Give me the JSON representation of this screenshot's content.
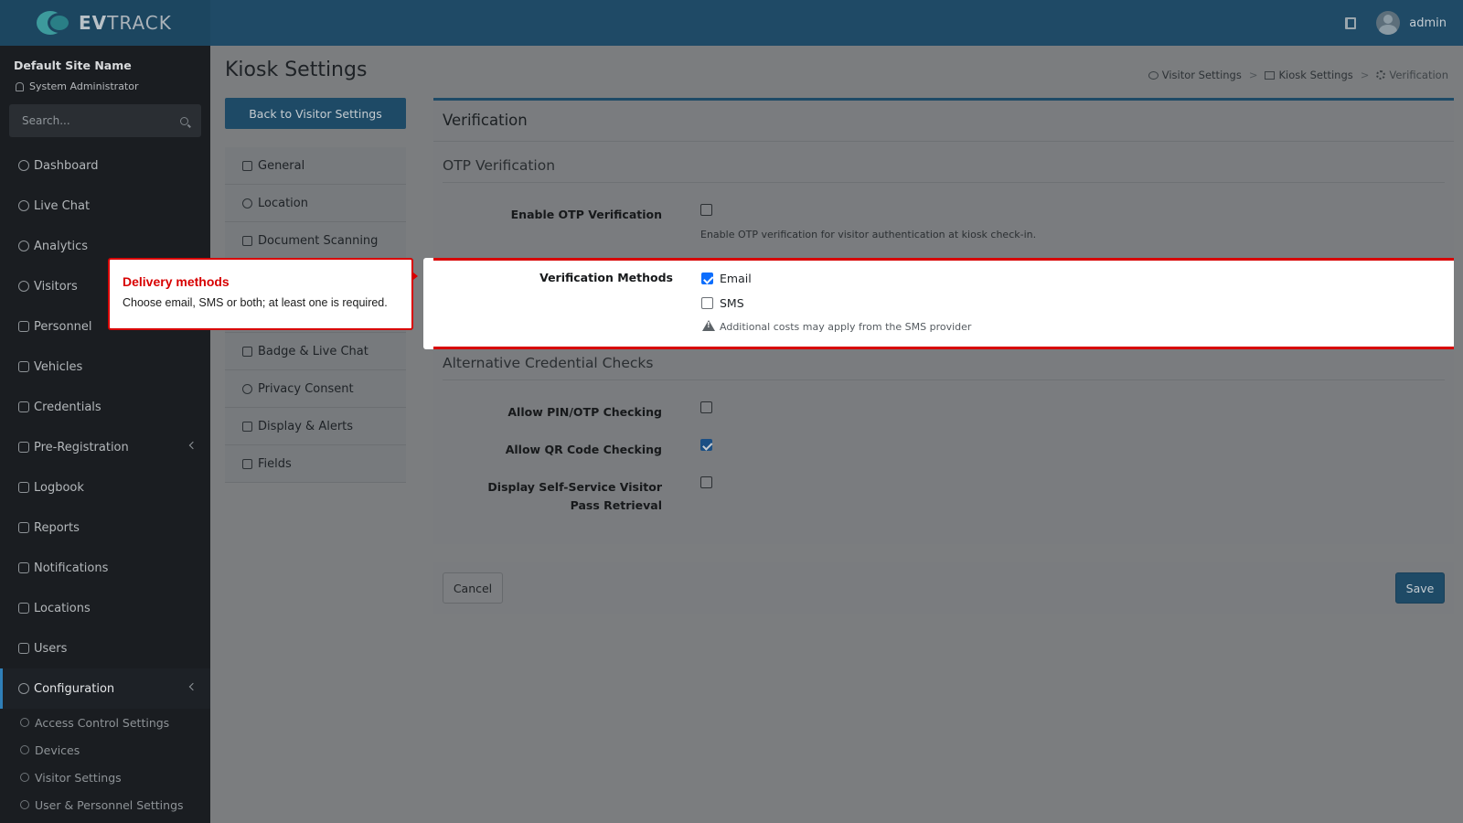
{
  "brand": {
    "name_bold": "EV",
    "name_rest": "TRACK"
  },
  "topbar": {
    "user_name": "admin"
  },
  "sidebar": {
    "site_name": "Default Site Name",
    "role": "System Administrator",
    "search_placeholder": "Search...",
    "items": [
      {
        "label": "Dashboard"
      },
      {
        "label": "Live Chat"
      },
      {
        "label": "Analytics"
      },
      {
        "label": "Visitors"
      },
      {
        "label": "Personnel"
      },
      {
        "label": "Vehicles"
      },
      {
        "label": "Credentials"
      },
      {
        "label": "Pre-Registration"
      },
      {
        "label": "Logbook"
      },
      {
        "label": "Reports"
      },
      {
        "label": "Notifications"
      },
      {
        "label": "Locations"
      },
      {
        "label": "Users"
      },
      {
        "label": "Configuration"
      }
    ],
    "sub_items": [
      {
        "label": "Access Control Settings"
      },
      {
        "label": "Devices"
      },
      {
        "label": "Visitor Settings"
      },
      {
        "label": "User & Personnel Settings"
      }
    ]
  },
  "page": {
    "title": "Kiosk Settings",
    "back_button": "Back to Visitor Settings"
  },
  "breadcrumb": [
    "Visitor Settings",
    "Kiosk Settings",
    "Verification"
  ],
  "kiosk_nav": [
    {
      "label": "General"
    },
    {
      "label": "Location"
    },
    {
      "label": "Document Scanning"
    },
    {
      "label": "Badge & Live Chat"
    },
    {
      "label": "Privacy Consent"
    },
    {
      "label": "Display & Alerts"
    },
    {
      "label": "Fields"
    }
  ],
  "card": {
    "title": "Verification",
    "otp_section": "OTP Verification",
    "enable_otp_label": "Enable OTP Verification",
    "enable_otp_checked": false,
    "enable_otp_help": "Enable OTP verification for visitor authentication at kiosk check-in.",
    "methods_label": "Verification Methods",
    "method_email": "Email",
    "method_email_checked": true,
    "method_sms": "SMS",
    "method_sms_checked": false,
    "sms_warning": "Additional costs may apply from the SMS provider",
    "alt_section": "Alternative Credential Checks",
    "pin_label": "Allow PIN/OTP Checking",
    "pin_checked": false,
    "qr_label": "Allow QR Code Checking",
    "qr_checked": true,
    "selfservice_label": "Display Self-Service Visitor Pass Retrieval",
    "selfservice_checked": false
  },
  "callout": {
    "title": "Delivery methods",
    "body": "Choose email, SMS or both; at least one is required."
  },
  "actions": {
    "cancel": "Cancel",
    "save": "Save"
  },
  "colors": {
    "primary": "#1e4a66",
    "highlight_border": "#d80000",
    "checkbox_checked": "#0d6efd"
  }
}
